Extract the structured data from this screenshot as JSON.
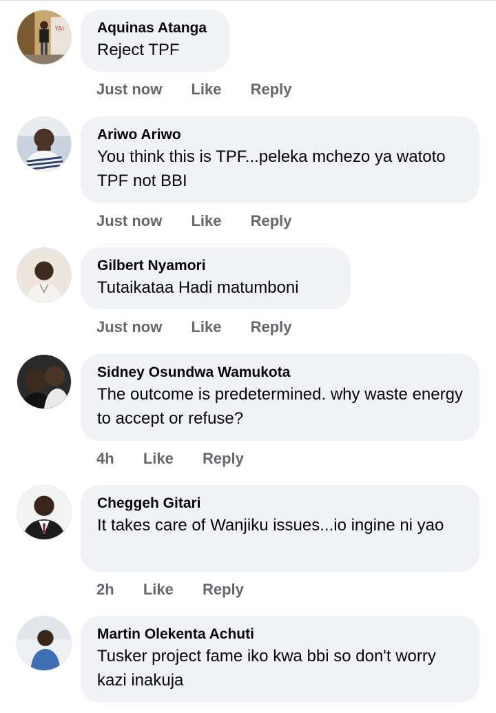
{
  "comments": [
    {
      "author": "Aquinas Atanga",
      "text": "Reject TPF",
      "time": "Just now",
      "like": "Like",
      "reply": "Reply",
      "avatar": "person-standing-avatar-icon"
    },
    {
      "author": "Ariwo Ariwo",
      "text": "You think this is TPF...peleka mchezo ya watoto TPF not BBI",
      "time": "Just now",
      "like": "Like",
      "reply": "Reply",
      "avatar": "smiling-man-avatar-icon"
    },
    {
      "author": "Gilbert Nyamori",
      "text": "Tutaikataa Hadi matumboni",
      "time": "Just now",
      "like": "Like",
      "reply": "Reply",
      "avatar": "man-portrait-avatar-icon"
    },
    {
      "author": "Sidney Osundwa Wamukota",
      "text": "The outcome is predetermined. why waste energy to accept or refuse?",
      "time": "4h",
      "like": "Like",
      "reply": "Reply",
      "avatar": "couple-avatar-icon"
    },
    {
      "author": "Cheggeh Gitari",
      "text": "It takes care of Wanjiku issues...io ingine ni yao",
      "time": "2h",
      "like": "Like",
      "reply": "Reply",
      "avatar": "man-suit-avatar-icon"
    },
    {
      "author": "Martin Olekenta Achuti",
      "text": "Tusker project fame iko kwa bbi so don't worry kazi inakuja",
      "time": "",
      "like": "",
      "reply": "",
      "avatar": "man-blue-shirt-avatar-icon"
    }
  ]
}
